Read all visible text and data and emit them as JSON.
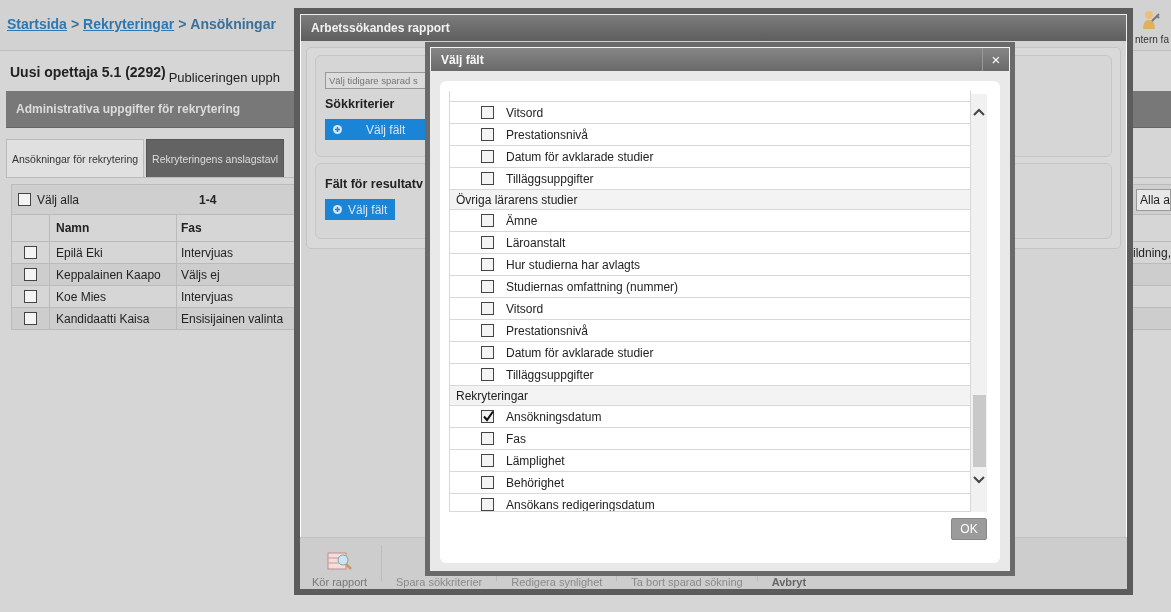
{
  "breadcrumb": [
    {
      "label": "Startsida",
      "kind": "link"
    },
    {
      "label": "Rekryteringar",
      "kind": "link",
      "separator": ">"
    },
    {
      "label": "Ansökningar",
      "kind": "current",
      "separator": ">"
    }
  ],
  "header_tool": {
    "label": "ntern fa"
  },
  "page_title": {
    "code": "Uusi opettaja 5.1 (2292)",
    "status": "Publiceringen upph"
  },
  "section_bar": {
    "title": "Administrativa uppgifter för rekrytering"
  },
  "tabs": [
    {
      "label": "Ansökningar för rekrytering",
      "selected": true
    },
    {
      "label": "Rekryteringens anslagstavl",
      "selected": false
    }
  ],
  "table": {
    "select_all": {
      "label": "Välj alla",
      "checked": false
    },
    "range": "1-4",
    "filter_value": "Alla a",
    "columns": [
      "Namn",
      "Fas"
    ],
    "rows": [
      {
        "checked": false,
        "name": "Epilä Eki",
        "phase": "Intervjuas",
        "column_3": "ildning,"
      },
      {
        "checked": false,
        "name": "Keppalainen Kaapo",
        "phase": "Väljs ej"
      },
      {
        "checked": false,
        "name": "Koe Mies",
        "phase": "Intervjuas"
      },
      {
        "checked": false,
        "name": "Kandidaatti Kaisa",
        "phase": "Ensisijainen valinta"
      }
    ]
  },
  "report_dialog": {
    "title": "Arbetssökandes rapport",
    "saved_search": {
      "placeholder": "Välj tidigare sparad s"
    },
    "sections": [
      {
        "heading": "Sökkriterier",
        "button": "Välj fält"
      },
      {
        "heading": "Fält för resultatv",
        "button": "Välj fält"
      }
    ],
    "toolbar": [
      {
        "label": "Kör rapport",
        "kind": "icon",
        "disabled": false
      },
      {
        "label": "Spara sökkriterier",
        "kind": "text",
        "disabled": true
      },
      {
        "label": "Redigera synlighet",
        "kind": "text",
        "disabled": true
      },
      {
        "label": "Ta bort sparad sökning",
        "kind": "text",
        "disabled": true
      },
      {
        "label": "Avbryt",
        "kind": "text",
        "disabled": false
      }
    ]
  },
  "field_dialog": {
    "title": "Välj fält",
    "close": "×",
    "ok_button": "OK",
    "groups": [
      {
        "fields": [
          {
            "label": "Vitsord",
            "checked": false
          },
          {
            "label": "Prestationsnivå",
            "checked": false
          },
          {
            "label": "Datum för avklarade studier",
            "checked": false
          },
          {
            "label": "Tilläggsuppgifter",
            "checked": false
          }
        ]
      },
      {
        "heading": "Övriga lärarens studier",
        "fields": [
          {
            "label": "Ämne",
            "checked": false
          },
          {
            "label": "Läroanstalt",
            "checked": false
          },
          {
            "label": "Hur studierna har avlagts",
            "checked": false
          },
          {
            "label": "Studiernas omfattning (nummer)",
            "checked": false
          },
          {
            "label": "Vitsord",
            "checked": false
          },
          {
            "label": "Prestationsnivå",
            "checked": false
          },
          {
            "label": "Datum för avklarade studier",
            "checked": false
          },
          {
            "label": "Tilläggsuppgifter",
            "checked": false
          }
        ]
      },
      {
        "heading": "Rekryteringar",
        "fields": [
          {
            "label": "Ansökningsdatum",
            "checked": true
          },
          {
            "label": "Fas",
            "checked": false
          },
          {
            "label": "Lämplighet",
            "checked": false
          },
          {
            "label": "Behörighet",
            "checked": false
          },
          {
            "label": "Ansökans redigeringsdatum",
            "checked": false
          }
        ]
      }
    ]
  }
}
